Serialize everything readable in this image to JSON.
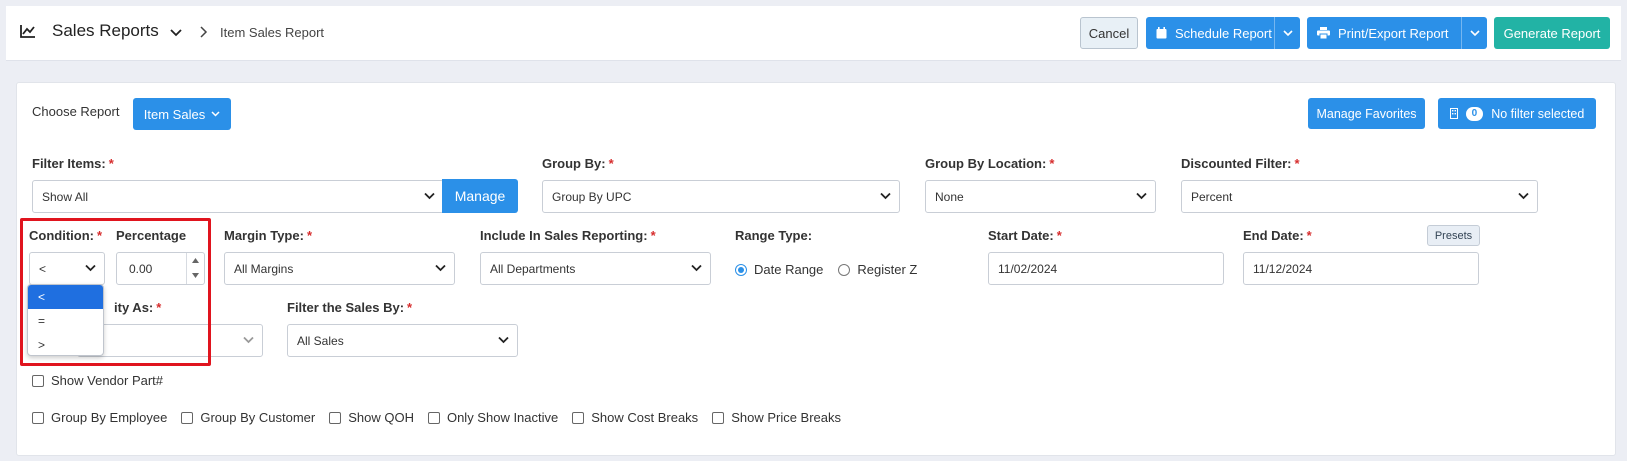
{
  "header": {
    "title": "Sales Reports",
    "breadcrumb": "Item Sales Report",
    "cancel_label": "Cancel",
    "schedule_label": "Schedule Report",
    "print_label": "Print/Export Report",
    "generate_label": "Generate Report"
  },
  "report": {
    "choose_label": "Choose Report",
    "report_value": "Item Sales",
    "manage_favorites": "Manage Favorites",
    "filter_count": "0",
    "filter_text": "No filter selected"
  },
  "filters": {
    "filter_items_label": "Filter Items:",
    "filter_items_value": "Show All",
    "manage_label": "Manage",
    "group_by_label": "Group By:",
    "group_by_value": "Group By UPC",
    "group_by_location_label": "Group By Location:",
    "group_by_location_value": "None",
    "discounted_filter_label": "Discounted Filter:",
    "discounted_filter_value": "Percent",
    "condition_label": "Condition:",
    "condition_value": "<",
    "condition_options": [
      "<",
      "=",
      ">"
    ],
    "percentage_label": "Percentage",
    "percentage_value": "0.00",
    "margin_type_label": "Margin Type:",
    "margin_type_value": "All Margins",
    "include_label": "Include In Sales Reporting:",
    "include_value": "All Departments",
    "range_type_label": "Range Type:",
    "range_date": "Date Range",
    "range_register": "Register Z",
    "start_date_label": "Start Date:",
    "start_date_value": "11/02/2024",
    "end_date_label": "End Date:",
    "end_date_value": "11/12/2024",
    "presets_label": "Presets",
    "quantity_label_partial": "ity As:",
    "filter_sales_label": "Filter the Sales By:",
    "filter_sales_value": "All Sales"
  },
  "checkboxes": {
    "vendor_part": "Show Vendor Part#",
    "group_employee": "Group By Employee",
    "group_customer": "Group By Customer",
    "show_qoh": "Show QOH",
    "only_inactive": "Only Show Inactive",
    "cost_breaks": "Show Cost Breaks",
    "price_breaks": "Show Price Breaks"
  },
  "colors": {
    "primary": "#2b90e8",
    "teal": "#22b3a5",
    "required": "#d62c2c",
    "highlight": "#e0141e"
  }
}
